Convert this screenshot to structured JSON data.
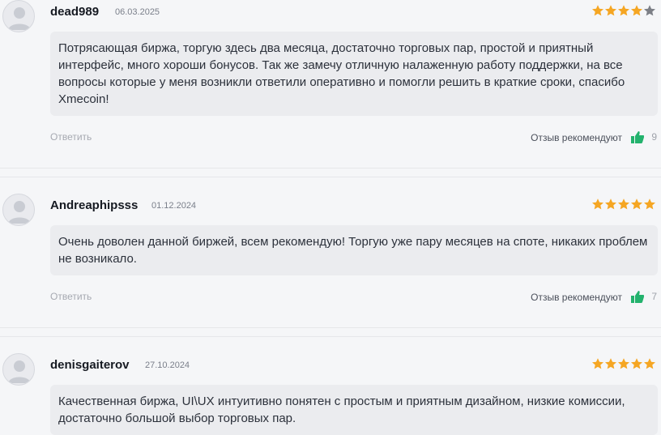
{
  "reviews": [
    {
      "username": "dead989",
      "date": "06.03.2025",
      "rating": 4,
      "text": "Потрясающая биржа, торгую здесь два месяца, достаточно торговых пар, простой и приятный интерфейс, много хороши бонусов. Так же замечу отличную налаженную работу поддержки, на все вопросы которые у меня возникли ответили оперативно и помогли решить в краткие сроки, спасибо Xmecoin!",
      "reply_label": "Ответить",
      "recommend_label": "Отзыв рекомендуют",
      "likes": "9"
    },
    {
      "username": "Andreaphipsss",
      "date": "01.12.2024",
      "rating": 5,
      "text": "Очень доволен данной биржей, всем рекомендую! Торгую уже пару месяцев на споте, никаких проблем не возникало.",
      "reply_label": "Ответить",
      "recommend_label": "Отзыв рекомендуют",
      "likes": "7"
    },
    {
      "username": "denisgaiterov",
      "date": "27.10.2024",
      "rating": 5,
      "text": "Качественная биржа, UI\\UX интуитивно понятен с простым и приятным дизайном, низкие комиссии, достаточно большой выбор торговых пар."
    }
  ],
  "colors": {
    "star_filled": "#f5a623",
    "star_empty": "#7c7f86",
    "thumb": "#23b26d",
    "comment_bg": "#ebecef"
  },
  "icons": {
    "avatar": "user-avatar-icon",
    "star": "star-icon",
    "thumb": "thumbs-up-icon"
  }
}
